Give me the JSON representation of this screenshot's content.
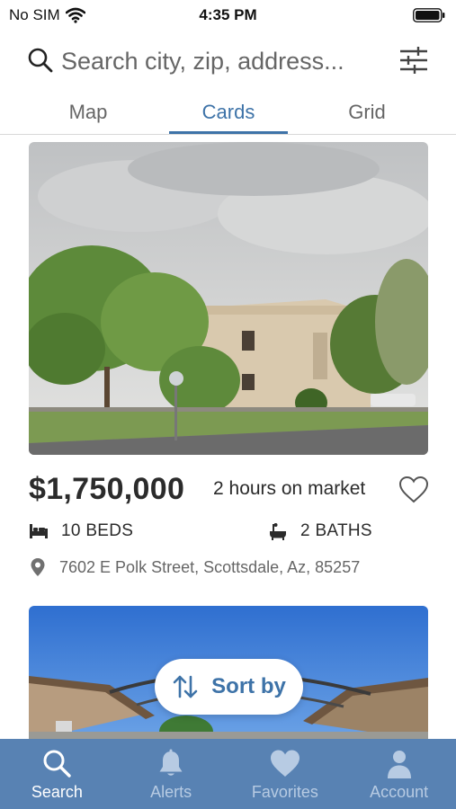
{
  "status_bar": {
    "carrier": "No SIM",
    "time": "4:35 PM"
  },
  "search": {
    "placeholder": "Search city, zip, address..."
  },
  "tabs": [
    {
      "label": "Map"
    },
    {
      "label": "Cards"
    },
    {
      "label": "Grid"
    }
  ],
  "listing": {
    "price": "$1,750,000",
    "market_time": "2 hours on market",
    "beds": "10 BEDS",
    "baths": "2 BATHS",
    "address": "7602 E Polk Street, Scottsdale, Az, 85257"
  },
  "sort": {
    "label": "Sort by"
  },
  "bottom_nav": [
    {
      "label": "Search",
      "icon": "search-icon",
      "active": true
    },
    {
      "label": "Alerts",
      "icon": "bell-icon",
      "active": false
    },
    {
      "label": "Favorites",
      "icon": "heart-icon",
      "active": false
    },
    {
      "label": "Account",
      "icon": "person-icon",
      "active": false
    }
  ],
  "colors": {
    "accent": "#3e73a8",
    "nav_background": "#5882b3",
    "nav_inactive": "#b7cbe3"
  }
}
